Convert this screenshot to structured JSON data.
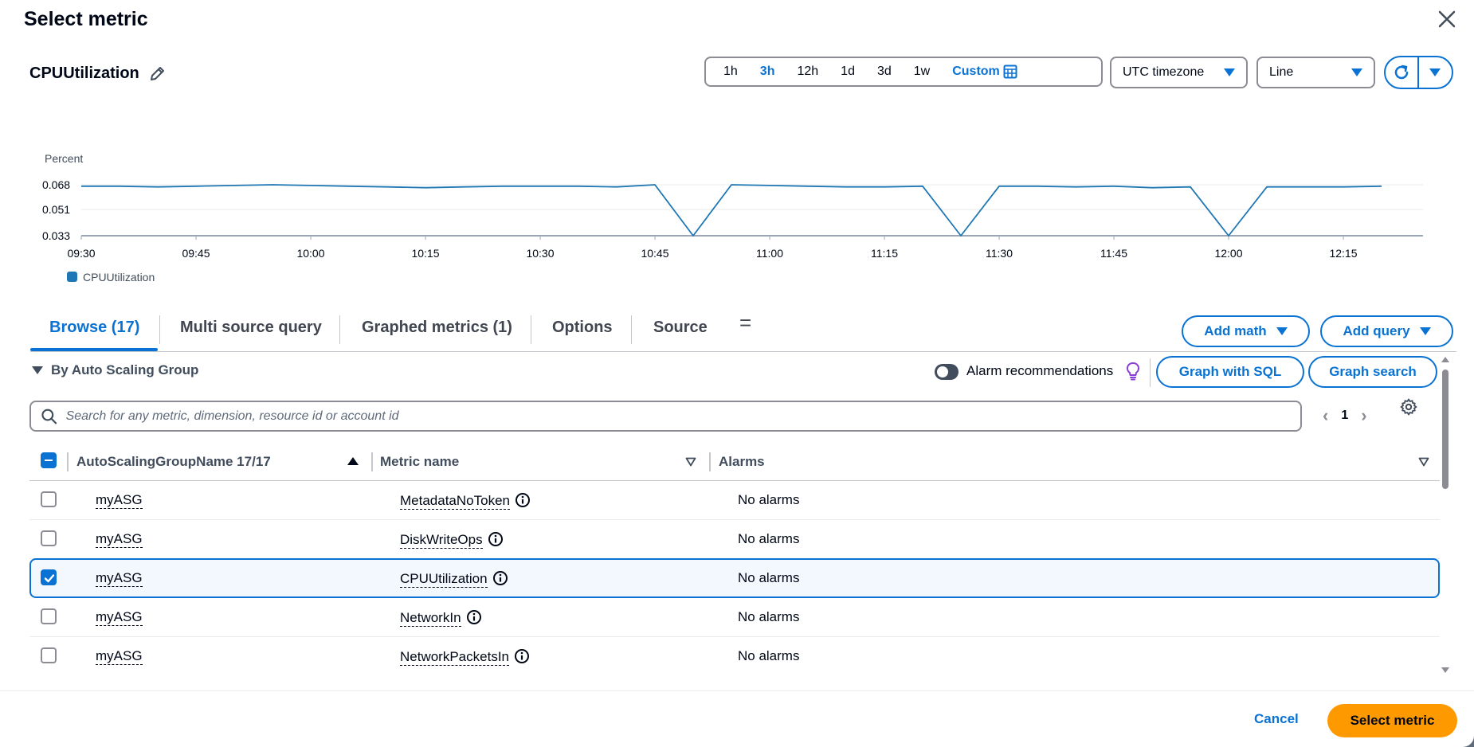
{
  "modal": {
    "title": "Select metric"
  },
  "metric": {
    "title": "CPUUtilization"
  },
  "time_range": {
    "options": [
      "1h",
      "3h",
      "12h",
      "1d",
      "3d",
      "1w"
    ],
    "active": "3h",
    "custom_label": "Custom"
  },
  "timezone": {
    "value": "UTC timezone"
  },
  "chart_type": {
    "value": "Line"
  },
  "chart_data": {
    "type": "line",
    "ylabel": "Percent",
    "xlabel": "",
    "y_ticks": [
      "0.068",
      "0.051",
      "0.033"
    ],
    "x_ticks": [
      "09:30",
      "09:45",
      "10:00",
      "10:15",
      "10:30",
      "10:45",
      "11:00",
      "11:15",
      "11:30",
      "11:45",
      "12:00",
      "12:15"
    ],
    "ylim": [
      0.033,
      0.068
    ],
    "series": [
      {
        "name": "CPUUtilization",
        "color": "#1f77b4",
        "x": [
          "09:30",
          "09:35",
          "09:40",
          "09:45",
          "09:50",
          "09:55",
          "10:00",
          "10:05",
          "10:10",
          "10:15",
          "10:20",
          "10:25",
          "10:30",
          "10:35",
          "10:40",
          "10:45",
          "10:50",
          "10:55",
          "11:00",
          "11:05",
          "11:10",
          "11:15",
          "11:20",
          "11:25",
          "11:30",
          "11:35",
          "11:40",
          "11:45",
          "11:50",
          "11:55",
          "12:00",
          "12:05",
          "12:10",
          "12:15",
          "12:20"
        ],
        "values": [
          0.067,
          0.067,
          0.0665,
          0.067,
          0.0675,
          0.068,
          0.0675,
          0.067,
          0.0665,
          0.066,
          0.0665,
          0.067,
          0.067,
          0.067,
          0.0665,
          0.068,
          0.033,
          0.068,
          0.0675,
          0.067,
          0.0665,
          0.0665,
          0.067,
          0.033,
          0.067,
          0.067,
          0.0665,
          0.067,
          0.066,
          0.0665,
          0.033,
          0.0665,
          0.0665,
          0.0665,
          0.067
        ]
      }
    ],
    "legend": [
      "CPUUtilization"
    ]
  },
  "tabs": [
    {
      "label": "Browse (17)"
    },
    {
      "label": "Multi source query"
    },
    {
      "label": "Graphed metrics (1)"
    },
    {
      "label": "Options"
    },
    {
      "label": "Source"
    }
  ],
  "tab_menu_glyph": "=",
  "actions": {
    "add_math": "Add math",
    "add_query": "Add query",
    "graph_with_sql": "Graph with SQL",
    "graph_search": "Graph search"
  },
  "group": {
    "label": "By Auto Scaling Group"
  },
  "alarm_recommendations": {
    "label": "Alarm recommendations"
  },
  "search": {
    "placeholder": "Search for any metric, dimension, resource id or account id"
  },
  "pager": {
    "page": "1"
  },
  "table": {
    "headers": [
      "AutoScalingGroupName 17/17",
      "Metric name",
      "Alarms"
    ],
    "rows": [
      {
        "group": "myASG",
        "metric": "MetadataNoToken",
        "alarms": "No alarms",
        "checked": false
      },
      {
        "group": "myASG",
        "metric": "DiskWriteOps",
        "alarms": "No alarms",
        "checked": false
      },
      {
        "group": "myASG",
        "metric": "CPUUtilization",
        "alarms": "No alarms",
        "checked": true
      },
      {
        "group": "myASG",
        "metric": "NetworkIn",
        "alarms": "No alarms",
        "checked": false
      },
      {
        "group": "myASG",
        "metric": "NetworkPacketsIn",
        "alarms": "No alarms",
        "checked": false
      }
    ]
  },
  "footer": {
    "cancel": "Cancel",
    "select": "Select metric"
  }
}
